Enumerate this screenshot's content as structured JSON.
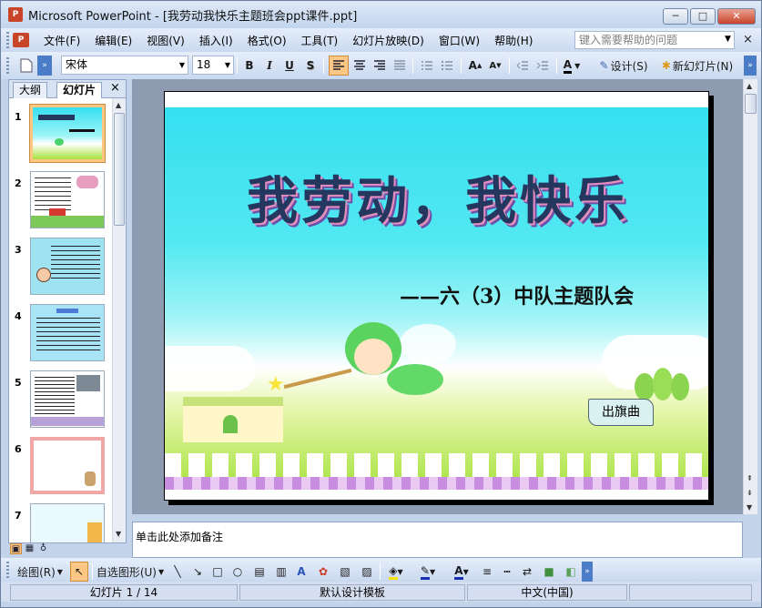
{
  "window": {
    "title": "Microsoft PowerPoint - [我劳动我快乐主题班会ppt课件.ppt]",
    "app_icon": "P",
    "minimize": "─",
    "restore": "□",
    "close": "✕"
  },
  "menu": {
    "items": [
      "文件(F)",
      "编辑(E)",
      "视图(V)",
      "插入(I)",
      "格式(O)",
      "工具(T)",
      "幻灯片放映(D)",
      "窗口(W)",
      "帮助(H)"
    ],
    "help_placeholder": "键入需要帮助的问题",
    "help_dropdown": "▼",
    "doc_close": "×"
  },
  "toolbar": {
    "font_name": "宋体",
    "font_size": "18",
    "bold": "B",
    "italic": "I",
    "underline": "U",
    "shadow": "S",
    "design_label": "设计(S)",
    "new_slide_label": "新幻灯片(N)"
  },
  "left_pane": {
    "tab_outline": "大纲",
    "tab_slides": "幻灯片",
    "close": "×",
    "slide_numbers": [
      "1",
      "2",
      "3",
      "4",
      "5",
      "6",
      "7"
    ]
  },
  "slide": {
    "title": "我劳动，我快乐",
    "subtitle": "——六（3）中队主题队会",
    "flag_label": "出旗曲"
  },
  "notes": {
    "placeholder": "单击此处添加备注"
  },
  "drawing_toolbar": {
    "draw_label": "绘图(R)",
    "autoshapes_label": "自选图形(U)"
  },
  "status": {
    "slide_position": "幻灯片 1 / 14",
    "template": "默认设计模板",
    "language": "中文(中国)"
  },
  "colors": {
    "chrome": "#c3d3ea",
    "active_button": "#ffc783",
    "sky": "#36dff0",
    "grass": "#a7e23d"
  }
}
